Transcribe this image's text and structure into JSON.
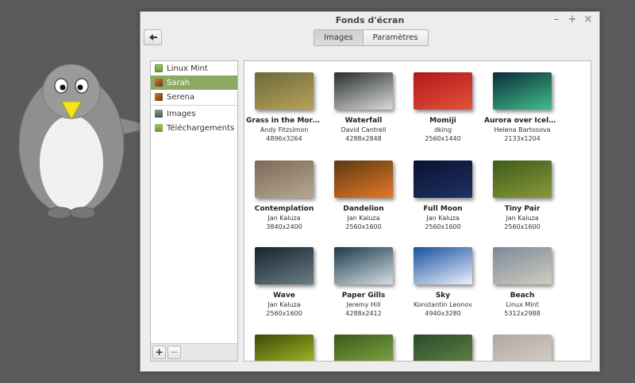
{
  "window": {
    "title": "Fonds d'écran",
    "minimize": "–",
    "maximize": "+",
    "close": "×"
  },
  "tabs": [
    {
      "label": "Images",
      "active": true
    },
    {
      "label": "Paramètres",
      "active": false
    }
  ],
  "sidebar": {
    "items": [
      {
        "label": "Linux Mint",
        "icon": "mint-folder-icon",
        "selected": false
      },
      {
        "label": "Sarah",
        "icon": "wallpaper-set-icon",
        "selected": true
      },
      {
        "label": "Serena",
        "icon": "wallpaper-set-icon",
        "selected": false
      }
    ],
    "folders": [
      {
        "label": "Images",
        "icon": "pictures-folder-icon"
      },
      {
        "label": "Téléchargements",
        "icon": "downloads-folder-icon"
      }
    ],
    "add_label": "+",
    "remove_label": "−"
  },
  "wallpapers": [
    {
      "title": "Grass in the Morn…",
      "author": "Andy Fitzsimon",
      "size": "4896x3264",
      "colors": [
        "#6b6a3a",
        "#b9a25a"
      ]
    },
    {
      "title": "Waterfall",
      "author": "David Cantrell",
      "size": "4288x2848",
      "colors": [
        "#2a2e2a",
        "#d9dcd8"
      ]
    },
    {
      "title": "Momiji",
      "author": "dking",
      "size": "2560x1440",
      "colors": [
        "#b1181a",
        "#e1523a"
      ]
    },
    {
      "title": "Aurora over Icela…",
      "author": "Helena Bartosova",
      "size": "2133x1204",
      "colors": [
        "#0d2a3a",
        "#3ec08a"
      ]
    },
    {
      "title": "Contemplation",
      "author": "Jan Kaluza",
      "size": "3840x2400",
      "colors": [
        "#7a6a58",
        "#b9a88f"
      ]
    },
    {
      "title": "Dandelion",
      "author": "Jan Kaluza",
      "size": "2560x1600",
      "colors": [
        "#5a3a10",
        "#e8772a"
      ]
    },
    {
      "title": "Full Moon",
      "author": "Jan Kaluza",
      "size": "2560x1600",
      "colors": [
        "#0a1130",
        "#1e3264"
      ]
    },
    {
      "title": "Tiny Pair",
      "author": "Jan Kaluza",
      "size": "2560x1600",
      "colors": [
        "#3c5a1a",
        "#8a9a3a"
      ]
    },
    {
      "title": "Wave",
      "author": "Jan Kaluza",
      "size": "2560x1600",
      "colors": [
        "#16242c",
        "#6c7e86"
      ]
    },
    {
      "title": "Paper Gills",
      "author": "Jeremy Hill",
      "size": "4288x2412",
      "colors": [
        "#1a3a4a",
        "#d5dfe4"
      ]
    },
    {
      "title": "Sky",
      "author": "Konstantin Leonov",
      "size": "4940x3280",
      "colors": [
        "#1a4fa0",
        "#eaf2fb"
      ]
    },
    {
      "title": "Beach",
      "author": "Linux Mint",
      "size": "5312x2988",
      "colors": [
        "#7a8a9a",
        "#d2ccc0"
      ]
    },
    {
      "title": "",
      "author": "",
      "size": "",
      "colors": [
        "#3a4a08",
        "#b8c82a"
      ]
    },
    {
      "title": "",
      "author": "",
      "size": "",
      "colors": [
        "#3a5a1a",
        "#8ab04a"
      ]
    },
    {
      "title": "",
      "author": "",
      "size": "",
      "colors": [
        "#2a4a2a",
        "#6a8a4a"
      ]
    },
    {
      "title": "",
      "author": "",
      "size": "",
      "colors": [
        "#b0a8a0",
        "#d8d4cc"
      ]
    }
  ]
}
